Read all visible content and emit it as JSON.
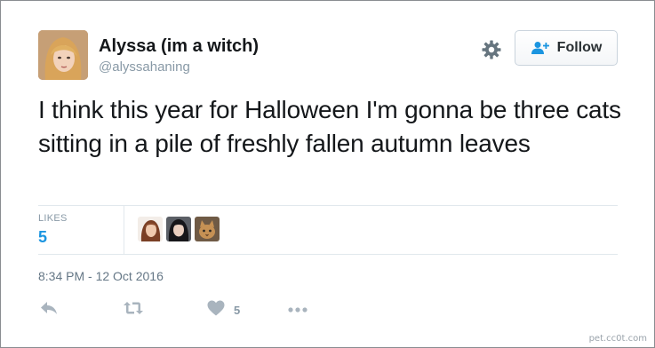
{
  "user": {
    "display_name": "Alyssa (im a witch)",
    "handle": "@alyssahaning",
    "avatar_icon": "profile-photo"
  },
  "follow_button": {
    "label": "Follow",
    "icon": "add-user-icon"
  },
  "tweet": {
    "text": "I think this year for Halloween I'm gonna be three cats sitting in a pile of freshly fallen autumn leaves"
  },
  "stats": {
    "likes_label": "LIKES",
    "likes_count": "5"
  },
  "timestamp": "8:34 PM - 12 Oct 2016",
  "actions": {
    "like_count": "5"
  },
  "watermark": "pet.cc0t.com",
  "colors": {
    "likes_blue": "#1b95e0",
    "icon_gray": "#a9b4be",
    "text": "#14171a"
  }
}
